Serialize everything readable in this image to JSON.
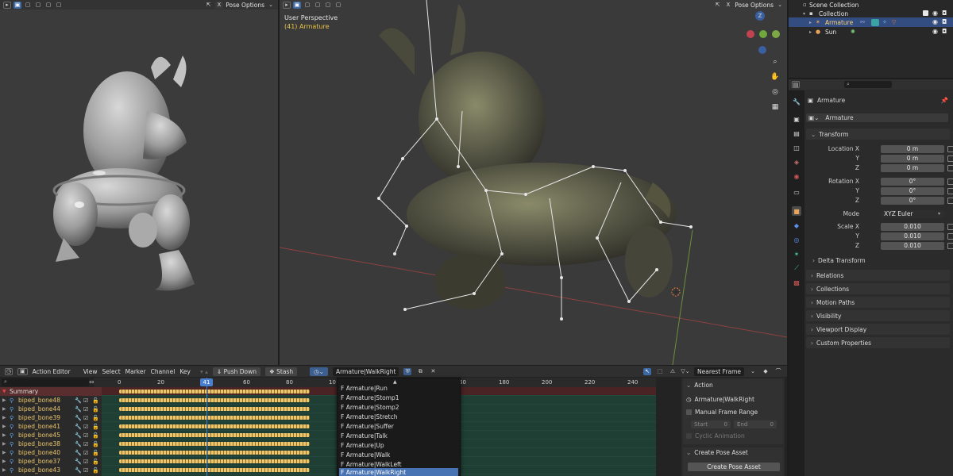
{
  "left_viewport": {
    "pose_options_label": "Pose Options"
  },
  "main_viewport": {
    "pose_options_label": "Pose Options",
    "perspective_label": "User Perspective",
    "object_label": "(41) Armature",
    "gizmo_axis_label": "Z",
    "gizmo_icons": [
      "z-axis-icon",
      "x-axis-icon",
      "y-axis-icon",
      "zoom-icon",
      "hand-icon",
      "camera-icon",
      "grid-icon"
    ]
  },
  "outliner": {
    "rows": [
      {
        "label": "Scene Collection"
      },
      {
        "label": "Collection"
      },
      {
        "label": "Armature"
      },
      {
        "label": "Sun"
      }
    ]
  },
  "properties": {
    "object_name": "Armature",
    "data_name": "Armature",
    "transform_label": "Transform",
    "location": {
      "label": "Location X",
      "x": "0 m",
      "y": "0 m",
      "z": "0 m"
    },
    "rotation": {
      "label": "Rotation X",
      "x": "0°",
      "y": "0°",
      "z": "0°"
    },
    "mode": {
      "label": "Mode",
      "value": "XYZ Euler"
    },
    "scale": {
      "label": "Scale X",
      "x": "0.010",
      "y": "0.010",
      "z": "0.010"
    },
    "axis_y": "Y",
    "axis_z": "Z",
    "sections": [
      "Delta Transform",
      "Relations",
      "Collections",
      "Motion Paths",
      "Visibility",
      "Viewport Display",
      "Custom Properties"
    ]
  },
  "action_editor": {
    "mode_label": "Action Editor",
    "menus": [
      "View",
      "Select",
      "Marker",
      "Channel",
      "Key"
    ],
    "push_down_label": "Push Down",
    "stash_label": "Stash",
    "action_name": "Armature|WalkRight",
    "snap_label": "Nearest Frame",
    "ruler_ticks": [
      "0",
      "20",
      "41",
      "60",
      "80",
      "10",
      "60",
      "180",
      "200",
      "220",
      "240"
    ],
    "current_frame": "41",
    "channels": [
      {
        "name": "Summary"
      },
      {
        "name": "biped_bone48"
      },
      {
        "name": "biped_bone44"
      },
      {
        "name": "biped_bone39"
      },
      {
        "name": "biped_bone41"
      },
      {
        "name": "biped_bone45"
      },
      {
        "name": "biped_bone38"
      },
      {
        "name": "biped_bone40"
      },
      {
        "name": "biped_bone37"
      },
      {
        "name": "biped_bone43"
      }
    ]
  },
  "action_dropdown": {
    "items": [
      "F Armature|Run",
      "F Armature|Stomp1",
      "F Armature|Stomp2",
      "F Armature|Stretch",
      "F Armature|Suffer",
      "F Armature|Talk",
      "F Armature|Up",
      "F Armature|Walk",
      "F Armature|WalkLeft",
      "F Armature|WalkRight"
    ],
    "selected_index": 9
  },
  "side_panel": {
    "action_header": "Action",
    "action_name": "Armature|WalkRight",
    "manual_frame_range": "Manual Frame Range",
    "start_label": "Start",
    "start_value": "0",
    "end_label": "End",
    "end_value": "0",
    "cyclic_label": "Cyclic Animation",
    "pose_asset_header": "Create Pose Asset",
    "pose_asset_button": "Create Pose Asset"
  },
  "colors": {
    "accent": "#4772b3",
    "keyframe": "#f0c66c",
    "channel_text": "#e9c46a",
    "key_area": "#1f3f35"
  }
}
